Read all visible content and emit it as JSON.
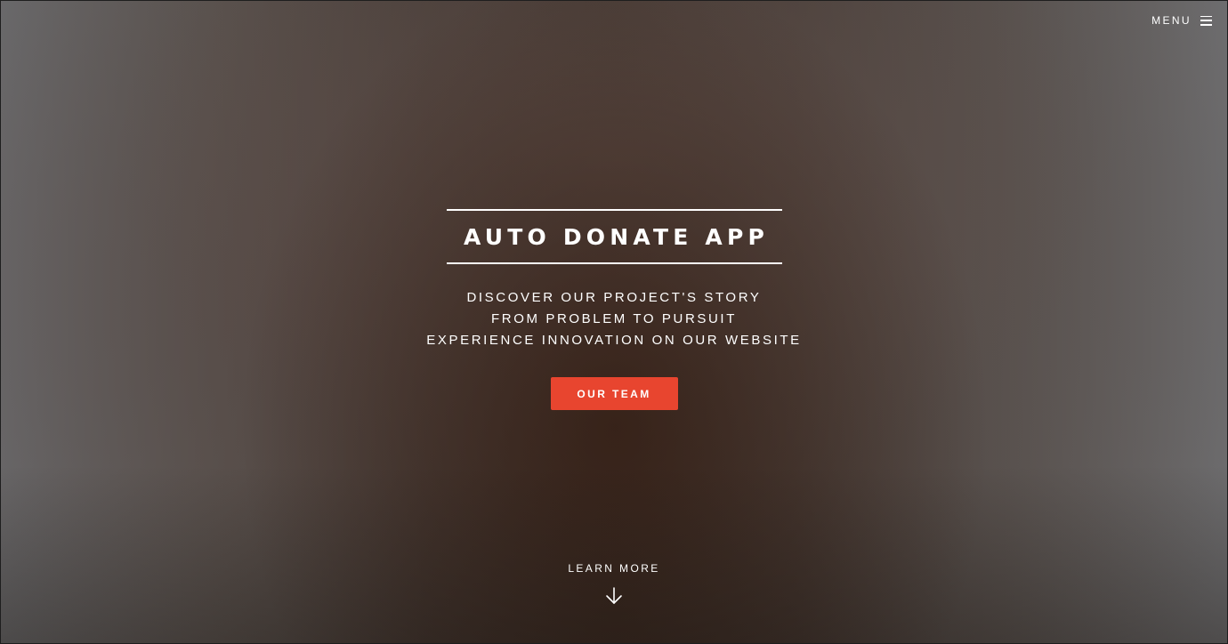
{
  "header": {
    "menu_label": "MENU",
    "menu_icon": "hamburger-icon"
  },
  "hero": {
    "title": "AUTO DONATE APP",
    "subtitle_lines": [
      "DISCOVER OUR PROJECT'S STORY",
      "FROM PROBLEM TO PURSUIT",
      "EXPERIENCE INNOVATION ON OUR WEBSITE"
    ],
    "cta_label": "OUR TEAM",
    "cta_color": "#e8452f"
  },
  "footer_link": {
    "label": "LEARN MORE",
    "icon": "arrow-down-icon"
  }
}
